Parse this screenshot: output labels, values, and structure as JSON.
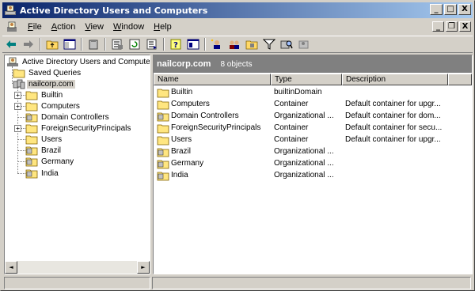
{
  "window": {
    "title": "Active Directory Users and Computers",
    "caption_buttons": {
      "minimize": "_",
      "maximize": "□",
      "close": "X"
    }
  },
  "menubar": {
    "items": [
      {
        "label": "File",
        "key": "F",
        "rest": "ile"
      },
      {
        "label": "Action",
        "key": "A",
        "rest": "ction"
      },
      {
        "label": "View",
        "key": "V",
        "rest": "iew"
      },
      {
        "label": "Window",
        "key": "W",
        "rest": "indow"
      },
      {
        "label": "Help",
        "key": "H",
        "rest": "elp"
      }
    ],
    "mdi_buttons": {
      "minimize": "_",
      "restore": "❐",
      "close": "X"
    }
  },
  "toolbar": {
    "buttons": [
      "back-icon",
      "forward-icon",
      "up-folder-icon",
      "show-hide-tree-icon",
      "delete-icon",
      "properties-icon",
      "refresh-icon",
      "export-list-icon",
      "help-icon",
      "mmc-help-icon",
      "new-user-icon",
      "new-group-icon",
      "new-ou-icon",
      "filter-icon",
      "find-icon",
      "add-to-group-icon"
    ]
  },
  "tree": {
    "root": "Active Directory Users and Computers [",
    "items": [
      {
        "label": "Saved Queries",
        "icon": "folder-icon"
      },
      {
        "label": "nailcorp.com",
        "icon": "domain-icon"
      },
      {
        "label": "Builtin",
        "icon": "folder-icon"
      },
      {
        "label": "Computers",
        "icon": "folder-icon"
      },
      {
        "label": "Domain Controllers",
        "icon": "ou-icon"
      },
      {
        "label": "ForeignSecurityPrincipals",
        "icon": "folder-icon"
      },
      {
        "label": "Users",
        "icon": "folder-icon"
      },
      {
        "label": "Brazil",
        "icon": "ou-icon"
      },
      {
        "label": "Germany",
        "icon": "ou-icon"
      },
      {
        "label": "India",
        "icon": "ou-icon"
      }
    ],
    "expander_plus": "+"
  },
  "right_pane": {
    "title": "nailcorp.com",
    "count": "8 objects",
    "columns": [
      "Name",
      "Type",
      "Description"
    ],
    "rows": [
      {
        "name": "Builtin",
        "type": "builtinDomain",
        "description": "",
        "icon": "folder-icon"
      },
      {
        "name": "Computers",
        "type": "Container",
        "description": "Default container for upgr...",
        "icon": "folder-icon"
      },
      {
        "name": "Domain Controllers",
        "type": "Organizational ...",
        "description": "Default container for dom...",
        "icon": "ou-icon"
      },
      {
        "name": "ForeignSecurityPrincipals",
        "type": "Container",
        "description": "Default container for secu...",
        "icon": "folder-icon"
      },
      {
        "name": "Users",
        "type": "Container",
        "description": "Default container for upgr...",
        "icon": "folder-icon"
      },
      {
        "name": "Brazil",
        "type": "Organizational ...",
        "description": "",
        "icon": "ou-icon"
      },
      {
        "name": "Germany",
        "type": "Organizational ...",
        "description": "",
        "icon": "ou-icon"
      },
      {
        "name": "India",
        "type": "Organizational ...",
        "description": "",
        "icon": "ou-icon"
      }
    ]
  },
  "scrollbar": {
    "left_arrow": "◄",
    "right_arrow": "►"
  },
  "colors": {
    "titlebar_start": "#0a246a",
    "titlebar_end": "#a6caf0",
    "face": "#d4d0c8",
    "pane_header": "#808080"
  }
}
